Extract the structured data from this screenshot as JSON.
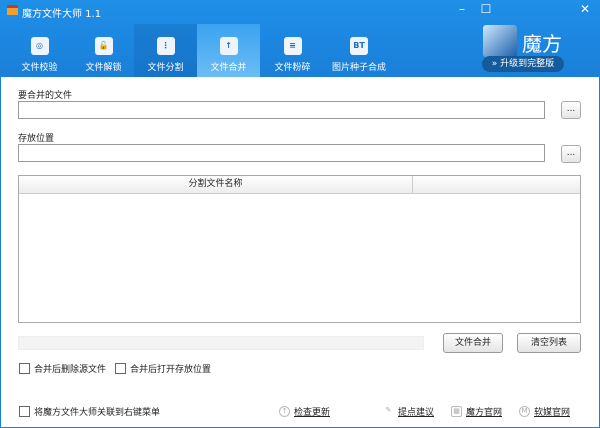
{
  "window": {
    "title": "魔方文件大师 1.1",
    "minimize": "–",
    "maximize": "☐",
    "close": "✕"
  },
  "tabs": [
    {
      "label": "文件校验",
      "icon": "magnifier-icon",
      "glyph": "◎"
    },
    {
      "label": "文件解锁",
      "icon": "unlock-icon",
      "glyph": "🔓"
    },
    {
      "label": "文件分割",
      "icon": "zip-split-icon",
      "glyph": "⋮"
    },
    {
      "label": "文件合并",
      "icon": "zip-merge-icon",
      "glyph": "↑"
    },
    {
      "label": "文件粉碎",
      "icon": "shredder-icon",
      "glyph": "≡"
    },
    {
      "label": "图片种子合成",
      "icon": "bt-icon",
      "glyph": "BT"
    }
  ],
  "brand": {
    "name": "魔方",
    "upgrade": "升级到完整版"
  },
  "form": {
    "source_label": "要合并的文件",
    "source_value": "",
    "browse": "...",
    "dest_label": "存放位置",
    "dest_value": ""
  },
  "table": {
    "columns": [
      "分割文件名称"
    ],
    "rows": []
  },
  "progress": 0,
  "buttons": {
    "merge": "文件合并",
    "clear": "清空列表"
  },
  "options": {
    "delete_source": "合并后删除源文件",
    "open_location": "合并后打开存放位置",
    "context_menu": "将魔方文件大师关联到右键菜单"
  },
  "footer": {
    "check_update": "检查更新",
    "feedback": "提点建议",
    "mofang_site": "魔方官网",
    "ruanmei_site": "软媒官网"
  }
}
